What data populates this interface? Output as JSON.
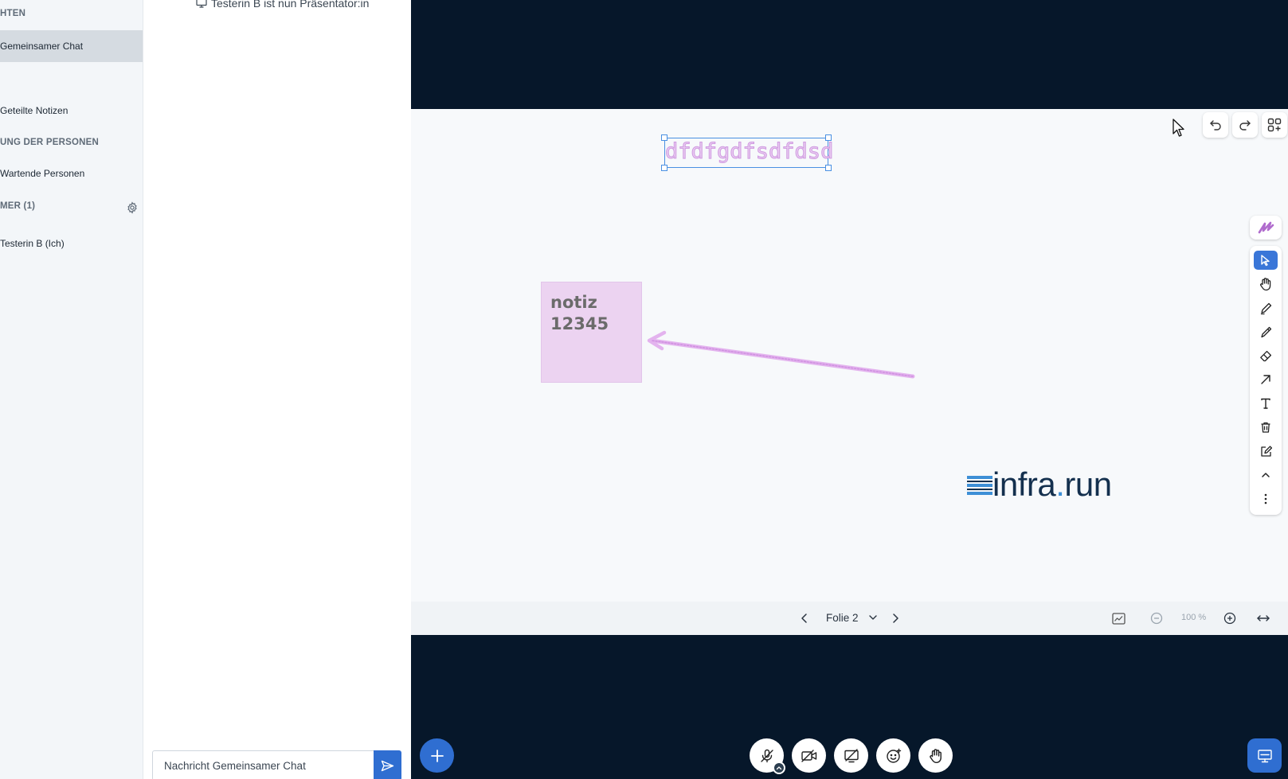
{
  "sidebar": {
    "messages_heading": "HTEN",
    "public_chat": "Gemeinsamer Chat",
    "shared_notes": "Geteilte Notizen",
    "manage_heading": "UNG DER PERSONEN",
    "waiting_users": "Wartende Personen",
    "users_heading": "MER (1)",
    "current_user": "Testerin B (Ich)"
  },
  "chat": {
    "system_message": "Testerin B ist nun Präsentator:in",
    "input_placeholder": "Nachricht Gemeinsamer Chat"
  },
  "whiteboard": {
    "text_annotation": "dfdfgdfsdfdsd",
    "sticky_note": "notiz\n12345",
    "logo_main": "infra",
    "logo_dot": ".",
    "logo_suffix": "run"
  },
  "slide_nav": {
    "current_slide": "Folie 2",
    "zoom": "100 %"
  },
  "colors": {
    "accent": "#2f6ed1",
    "dark_background": "#06172a",
    "annotation": "#cf9ae0",
    "sticky": "#ecd3f1"
  }
}
